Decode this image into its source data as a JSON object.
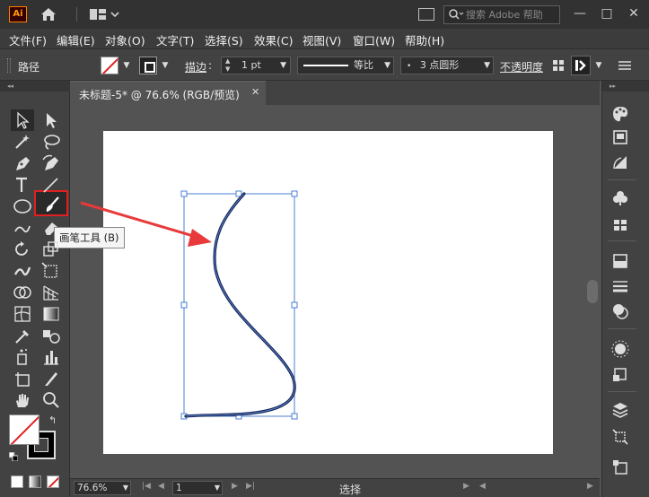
{
  "titlebar": {
    "app_logo": "Ai",
    "search_placeholder": "搜索 Adobe 帮助",
    "minimize": "—",
    "maximize": "□",
    "close": "✕"
  },
  "menu": [
    "文件(F)",
    "编辑(E)",
    "对象(O)",
    "文字(T)",
    "选择(S)",
    "效果(C)",
    "视图(V)",
    "窗口(W)",
    "帮助(H)"
  ],
  "control_bar": {
    "selection_type": "路径",
    "stroke_label": "描边",
    "stroke_weight": "1 pt",
    "variable_width": "等比",
    "brush_definition": "3 点圆形",
    "opacity_label": "不透明度"
  },
  "document_tab": {
    "title": "未标题-5* @ 76.6% (RGB/预览)",
    "close": "✕"
  },
  "tooltip": "画笔工具 (B)",
  "status_bar": {
    "zoom": "76.6%",
    "page": "1",
    "tool_status": "选择"
  },
  "colors": {
    "highlight": "#e02020",
    "arrow": "#e83a3a",
    "path_stroke": "#1a2b5a",
    "bounding_box": "#4a7fd6"
  },
  "icons": {
    "tools": [
      "selection-tool",
      "direct-selection-tool",
      "magic-wand-tool",
      "lasso-tool",
      "pen-tool",
      "curvature-tool",
      "type-tool",
      "line-segment-tool",
      "ellipse-tool",
      "paintbrush-tool",
      "shaper-tool",
      "eraser-tool",
      "rotate-tool",
      "scale-tool",
      "warp-tool",
      "free-transform-tool",
      "shape-builder-tool",
      "perspective-grid-tool",
      "mesh-tool",
      "gradient-tool",
      "eyedropper-tool",
      "blend-tool",
      "symbol-sprayer-tool",
      "column-graph-tool",
      "artboard-tool",
      "slice-tool",
      "hand-tool",
      "zoom-tool"
    ],
    "dock": [
      "color-panel",
      "color-guide-panel",
      "gradient-panel",
      "symbols-panel",
      "swatches-panel",
      "transparency-panel",
      "stroke-panel",
      "appearance-panel",
      "graphic-styles-panel",
      "links-panel",
      "layers-panel",
      "transform-panel",
      "artboards-panel"
    ]
  }
}
